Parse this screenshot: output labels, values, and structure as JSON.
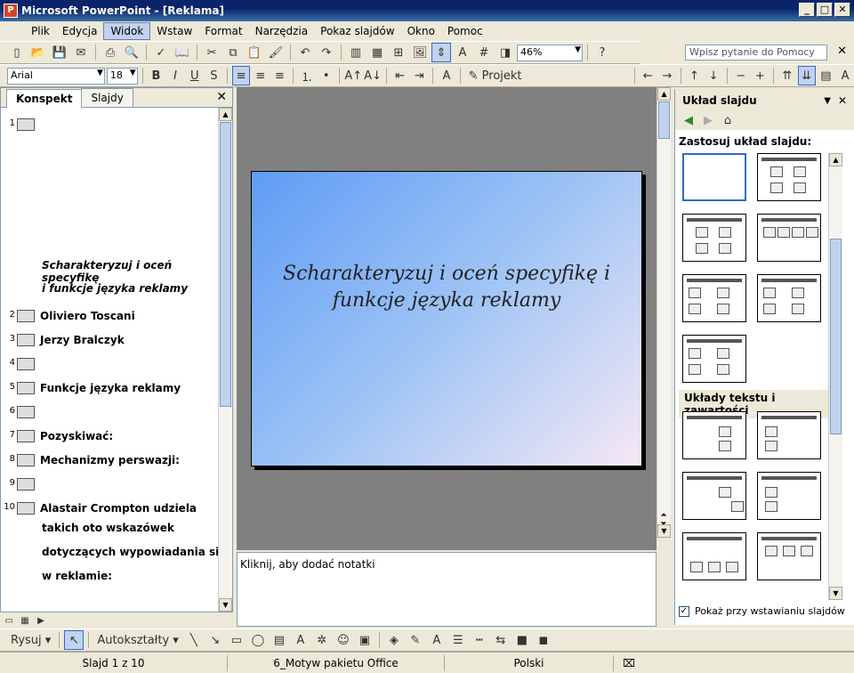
{
  "window": {
    "title": "Microsoft PowerPoint - [Reklama]",
    "min": "_",
    "max": "□",
    "close": "✕"
  },
  "menu": [
    "Plik",
    "Edycja",
    "Widok",
    "Wstaw",
    "Format",
    "Narzędzia",
    "Pokaz slajdów",
    "Okno",
    "Pomoc"
  ],
  "help_placeholder": "Wpisz pytanie do Pomocy",
  "toolbar": {
    "zoom": "46%",
    "font": "Arial",
    "size": "18",
    "design": "Projekt"
  },
  "left": {
    "tabs": [
      "Konspekt",
      "Slajdy"
    ],
    "outline": [
      {
        "num": "1",
        "text": ""
      },
      {
        "num": "",
        "text": "Scharakteryzuj i oceń specyfikę"
      },
      {
        "num": "",
        "text": "i funkcje języka reklamy"
      },
      {
        "num": "2",
        "text": "Oliviero Toscani"
      },
      {
        "num": "3",
        "text": "Jerzy Bralczyk"
      },
      {
        "num": "4",
        "text": ""
      },
      {
        "num": "5",
        "text": "Funkcje języka reklamy"
      },
      {
        "num": "6",
        "text": ""
      },
      {
        "num": "7",
        "text": "Pozyskiwać:"
      },
      {
        "num": "8",
        "text": "Mechanizmy perswazji:"
      },
      {
        "num": "9",
        "text": ""
      },
      {
        "num": "10",
        "text": "Alastair Crompton udziela"
      },
      {
        "num": "",
        "text": "takich oto wskazówek"
      },
      {
        "num": "",
        "text": "dotyczących wypowiadania się"
      },
      {
        "num": "",
        "text": "w reklamie:"
      }
    ]
  },
  "slide": {
    "title_line1": "Scharakteryzuj i oceń specyfikę i",
    "title_line2": "funkcje języka reklamy"
  },
  "notes_placeholder": "Kliknij, aby dodać notatki",
  "taskpane": {
    "title": "Układ slajdu",
    "apply_label": "Zastosuj układ slajdu:",
    "section2": "Układy tekstu i zawartości",
    "checkbox_label": "Pokaż przy wstawianiu slajdów"
  },
  "drawbar": {
    "draw": "Rysuj",
    "autoshapes": "Autokształty"
  },
  "status": {
    "slide": "Slajd 1 z 10",
    "theme": "6_Motyw pakietu Office",
    "lang": "Polski"
  }
}
